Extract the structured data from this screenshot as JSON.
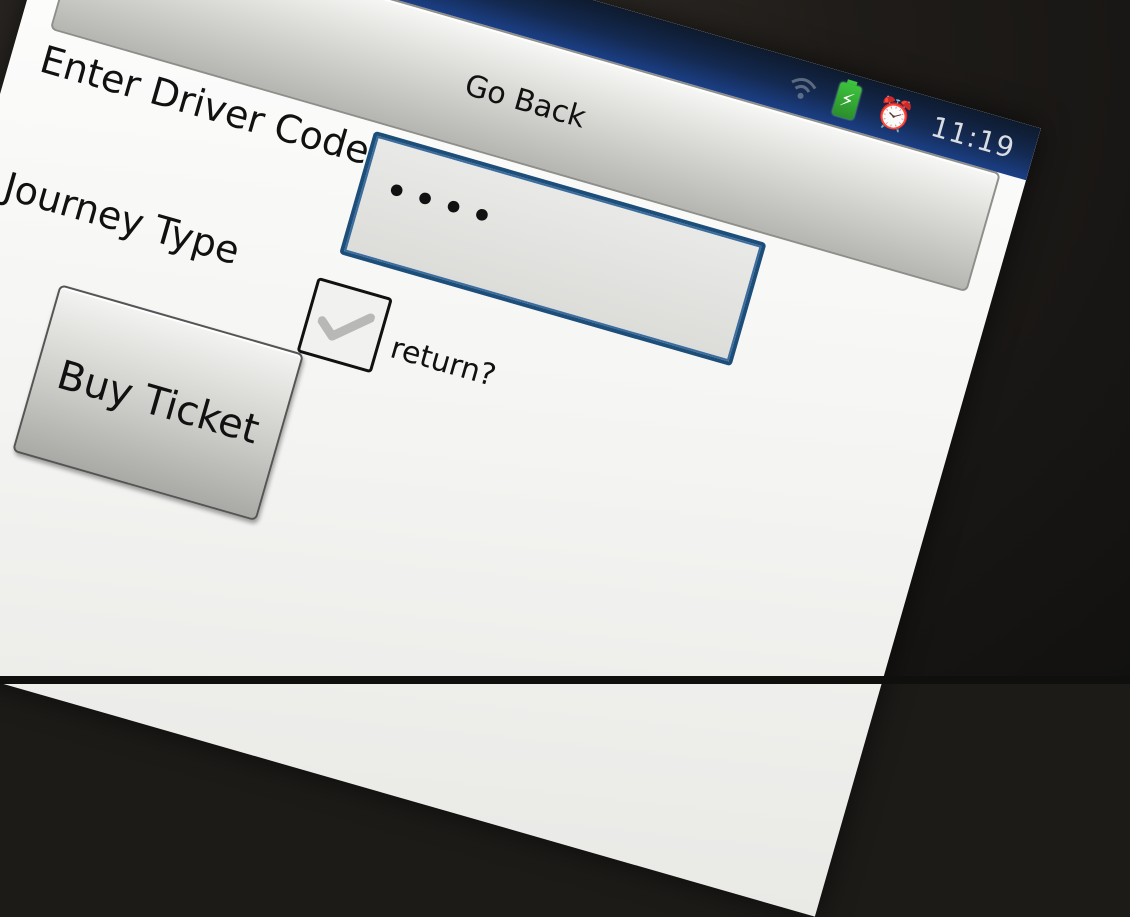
{
  "status_bar": {
    "time": "11:19",
    "icons": [
      "wifi-icon",
      "battery-charging-icon",
      "alarm-clock-icon"
    ],
    "background_color": "#1b3f86",
    "battery_color": "#3cc23c"
  },
  "go_back": {
    "label": "Go Back"
  },
  "driver_code": {
    "label": "Enter Driver Code",
    "masked_value": "••••",
    "border_color": "#1d4e7a"
  },
  "journey": {
    "label": "Journey Type",
    "return_checkbox": {
      "label": "return?",
      "checked": false
    }
  },
  "buy_ticket": {
    "label": "Buy Ticket"
  }
}
